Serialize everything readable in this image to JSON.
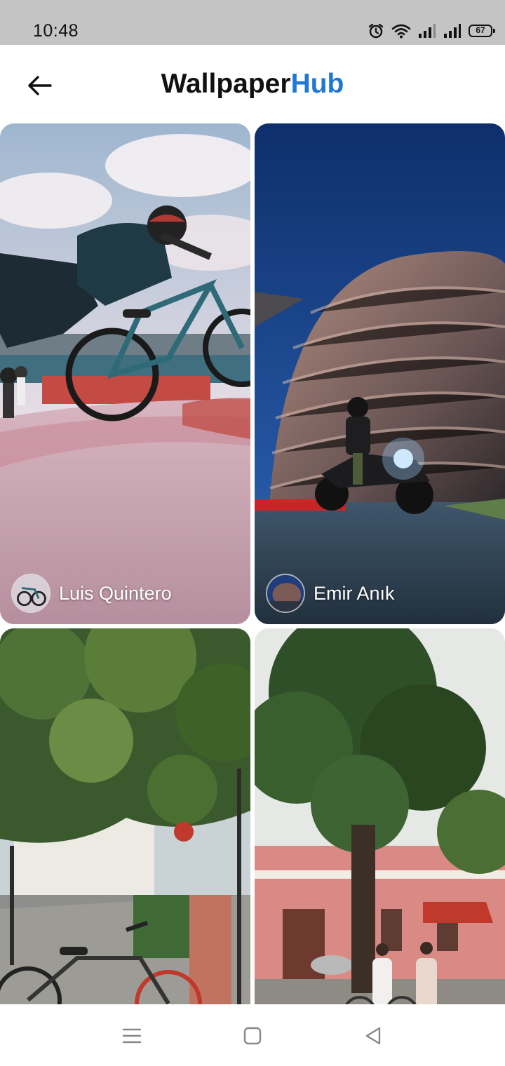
{
  "status_bar": {
    "time": "10:48",
    "battery": "67",
    "icons": [
      "alarm-icon",
      "wifi-icon",
      "signal-icon",
      "signal-icon",
      "battery-icon"
    ]
  },
  "header": {
    "title_part1": "Wallpaper",
    "title_part2": "Hub",
    "accent_color": "#1f79d4",
    "back_icon": "arrow-left-icon"
  },
  "wallpapers": [
    {
      "author": "Luis Quintero"
    },
    {
      "author": "Emir Anık"
    },
    {
      "author": ""
    },
    {
      "author": ""
    }
  ],
  "nav_bar": {
    "icons": [
      "menu-icon",
      "home-icon",
      "back-icon"
    ]
  }
}
